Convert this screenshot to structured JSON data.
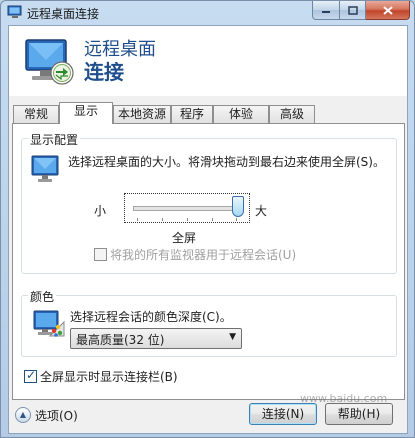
{
  "window": {
    "title": "远程桌面连接"
  },
  "header": {
    "title_line1": "远程桌面",
    "title_line2": "连接"
  },
  "tabs": [
    {
      "label": "常规"
    },
    {
      "label": "显示"
    },
    {
      "label": "本地资源"
    },
    {
      "label": "程序"
    },
    {
      "label": "体验"
    },
    {
      "label": "高级"
    }
  ],
  "display_config": {
    "group_title": "显示配置",
    "description": "选择远程桌面的大小。将滑块拖动到最右边来使用全屏(S)。",
    "slider_min_label": "小",
    "slider_max_label": "大",
    "slider_value_label": "全屏",
    "slider_level": 1.0,
    "all_monitors_label": "将我的所有监视器用于远程会话(U)",
    "all_monitors_checked": false
  },
  "colors": {
    "group_title": "颜色",
    "description": "选择远程会话的颜色深度(C)。",
    "selected_depth": "最高质量(32 位)"
  },
  "fullscreen_bar": {
    "label": "全屏显示时显示连接栏(B)",
    "checked": true
  },
  "footer": {
    "options_label": "选项(O)",
    "connect_label": "连接(N)",
    "help_label": "帮助(H)"
  },
  "watermark": "www.baidu.com"
}
